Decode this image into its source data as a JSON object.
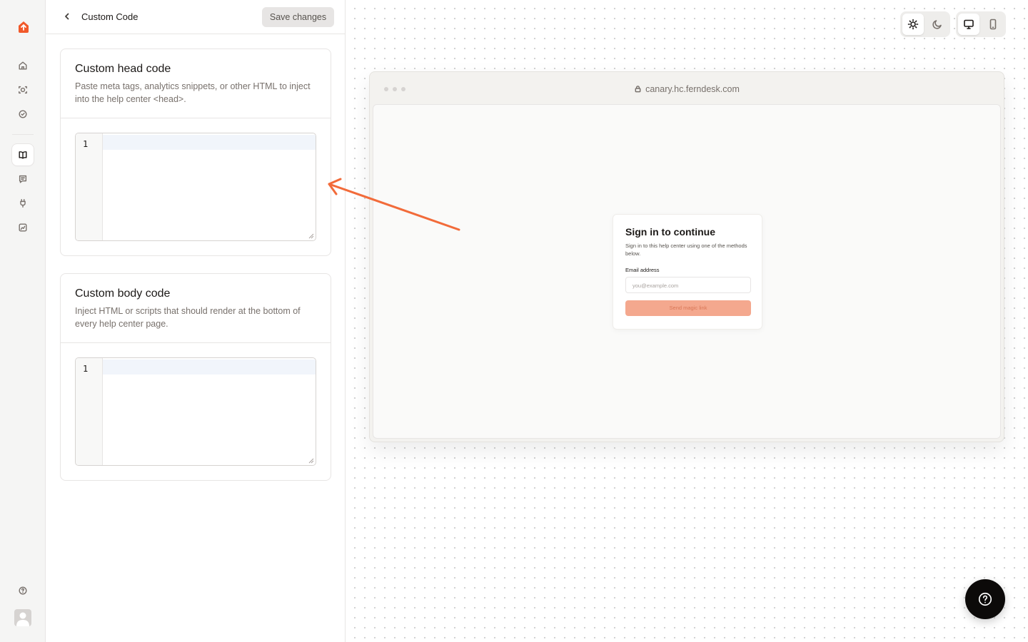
{
  "rail": {
    "items": [
      {
        "icon": "home-icon"
      },
      {
        "icon": "scan-face-icon"
      },
      {
        "icon": "check-badge-icon"
      },
      {
        "icon": "book-open-icon",
        "active": true
      },
      {
        "icon": "message-icon"
      },
      {
        "icon": "plug-icon"
      },
      {
        "icon": "analytics-icon"
      }
    ],
    "help_icon": "help-circle-icon",
    "brand_color": "#f1592a"
  },
  "header": {
    "title": "Custom Code",
    "save_label": "Save changes"
  },
  "head_card": {
    "title": "Custom head code",
    "description": "Paste meta tags, analytics snippets, or other HTML to inject into the help center <head>.",
    "line_number": "1"
  },
  "body_card": {
    "title": "Custom body code",
    "description": "Inject HTML or scripts that should render at the bottom of every help center page.",
    "line_number": "1"
  },
  "preview": {
    "theme_modes": [
      "light",
      "dark"
    ],
    "theme_selected": "light",
    "device_modes": [
      "desktop",
      "mobile"
    ],
    "device_selected": "desktop",
    "url": "canary.hc.ferndesk.com",
    "signin": {
      "title": "Sign in to continue",
      "description": "Sign in to this help center using one of the methods below.",
      "email_label": "Email address",
      "email_placeholder": "you@example.com",
      "button_label": "Send magic link"
    },
    "annotation_arrow_color": "#f26b3a"
  }
}
